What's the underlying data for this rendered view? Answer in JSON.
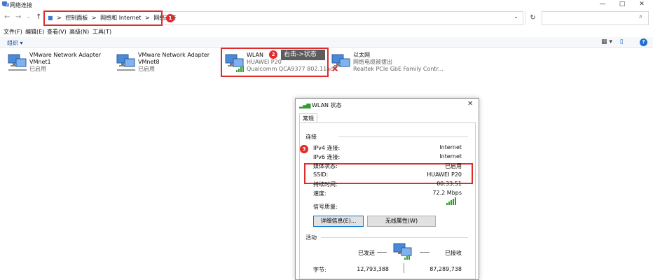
{
  "window": {
    "title": "网络连接",
    "min": "—",
    "max": "□",
    "close": "✕"
  },
  "nav": {
    "back": "←",
    "forward": "→",
    "dropdown": "⌄",
    "up": "↑"
  },
  "address": {
    "crumbs": [
      "控制面板",
      "网络和 Internet",
      "网络连接"
    ],
    "separator": ">",
    "dropdown": "⌄",
    "refresh": "↻",
    "search_icon": "⌕",
    "search_placeholder": ""
  },
  "badges": [
    "1",
    "2",
    "3"
  ],
  "menu": [
    "文件(F)",
    "编辑(E)",
    "查看(V)",
    "高级(N)",
    "工具(T)"
  ],
  "toolbar": {
    "organize": "组织 ▾",
    "view": "▦ ▾",
    "pane": "▯",
    "help": "?"
  },
  "adapters": [
    {
      "name": "VMware Network Adapter",
      "line2": "VMnet1",
      "line3": "已启用"
    },
    {
      "name": "VMware Network Adapter",
      "line2": "VMnet8",
      "line3": "已启用"
    },
    {
      "name": "WLAN",
      "line2": "HUAWEI P20",
      "line3": "Qualcomm QCA9377 802.11ac..."
    },
    {
      "name": "以太网",
      "line2": "网络电缆被拔出",
      "line3": "Realtek PCIe GbE Family Contr..."
    }
  ],
  "tooltip": "右击->状态",
  "dialog": {
    "title": "WLAN 状态",
    "close": "✕",
    "tab": "常规",
    "section_connection": "连接",
    "rows": [
      {
        "label": "IPv4 连接:",
        "value": "Internet"
      },
      {
        "label": "IPv6 连接:",
        "value": "Internet"
      },
      {
        "label": "媒体状态:",
        "value": "已启用"
      },
      {
        "label": "SSID:",
        "value": "HUAWEI P20"
      },
      {
        "label": "持续时间:",
        "value": "00:33:51"
      },
      {
        "label": "速度:",
        "value": "72.2 Mbps"
      }
    ],
    "signal_label": "信号质量:",
    "btn_details": "详细信息(E)...",
    "btn_wireless": "无线属性(W)",
    "section_activity": "活动",
    "sent_label": "已发送",
    "recv_label": "已接收",
    "bytes_label": "字节:",
    "bytes_sent": "12,793,388",
    "bytes_recv": "87,289,738"
  },
  "colors": {
    "highlight": "#e02b2b",
    "accent": "#0078d7",
    "signal": "#2e9e2e"
  }
}
